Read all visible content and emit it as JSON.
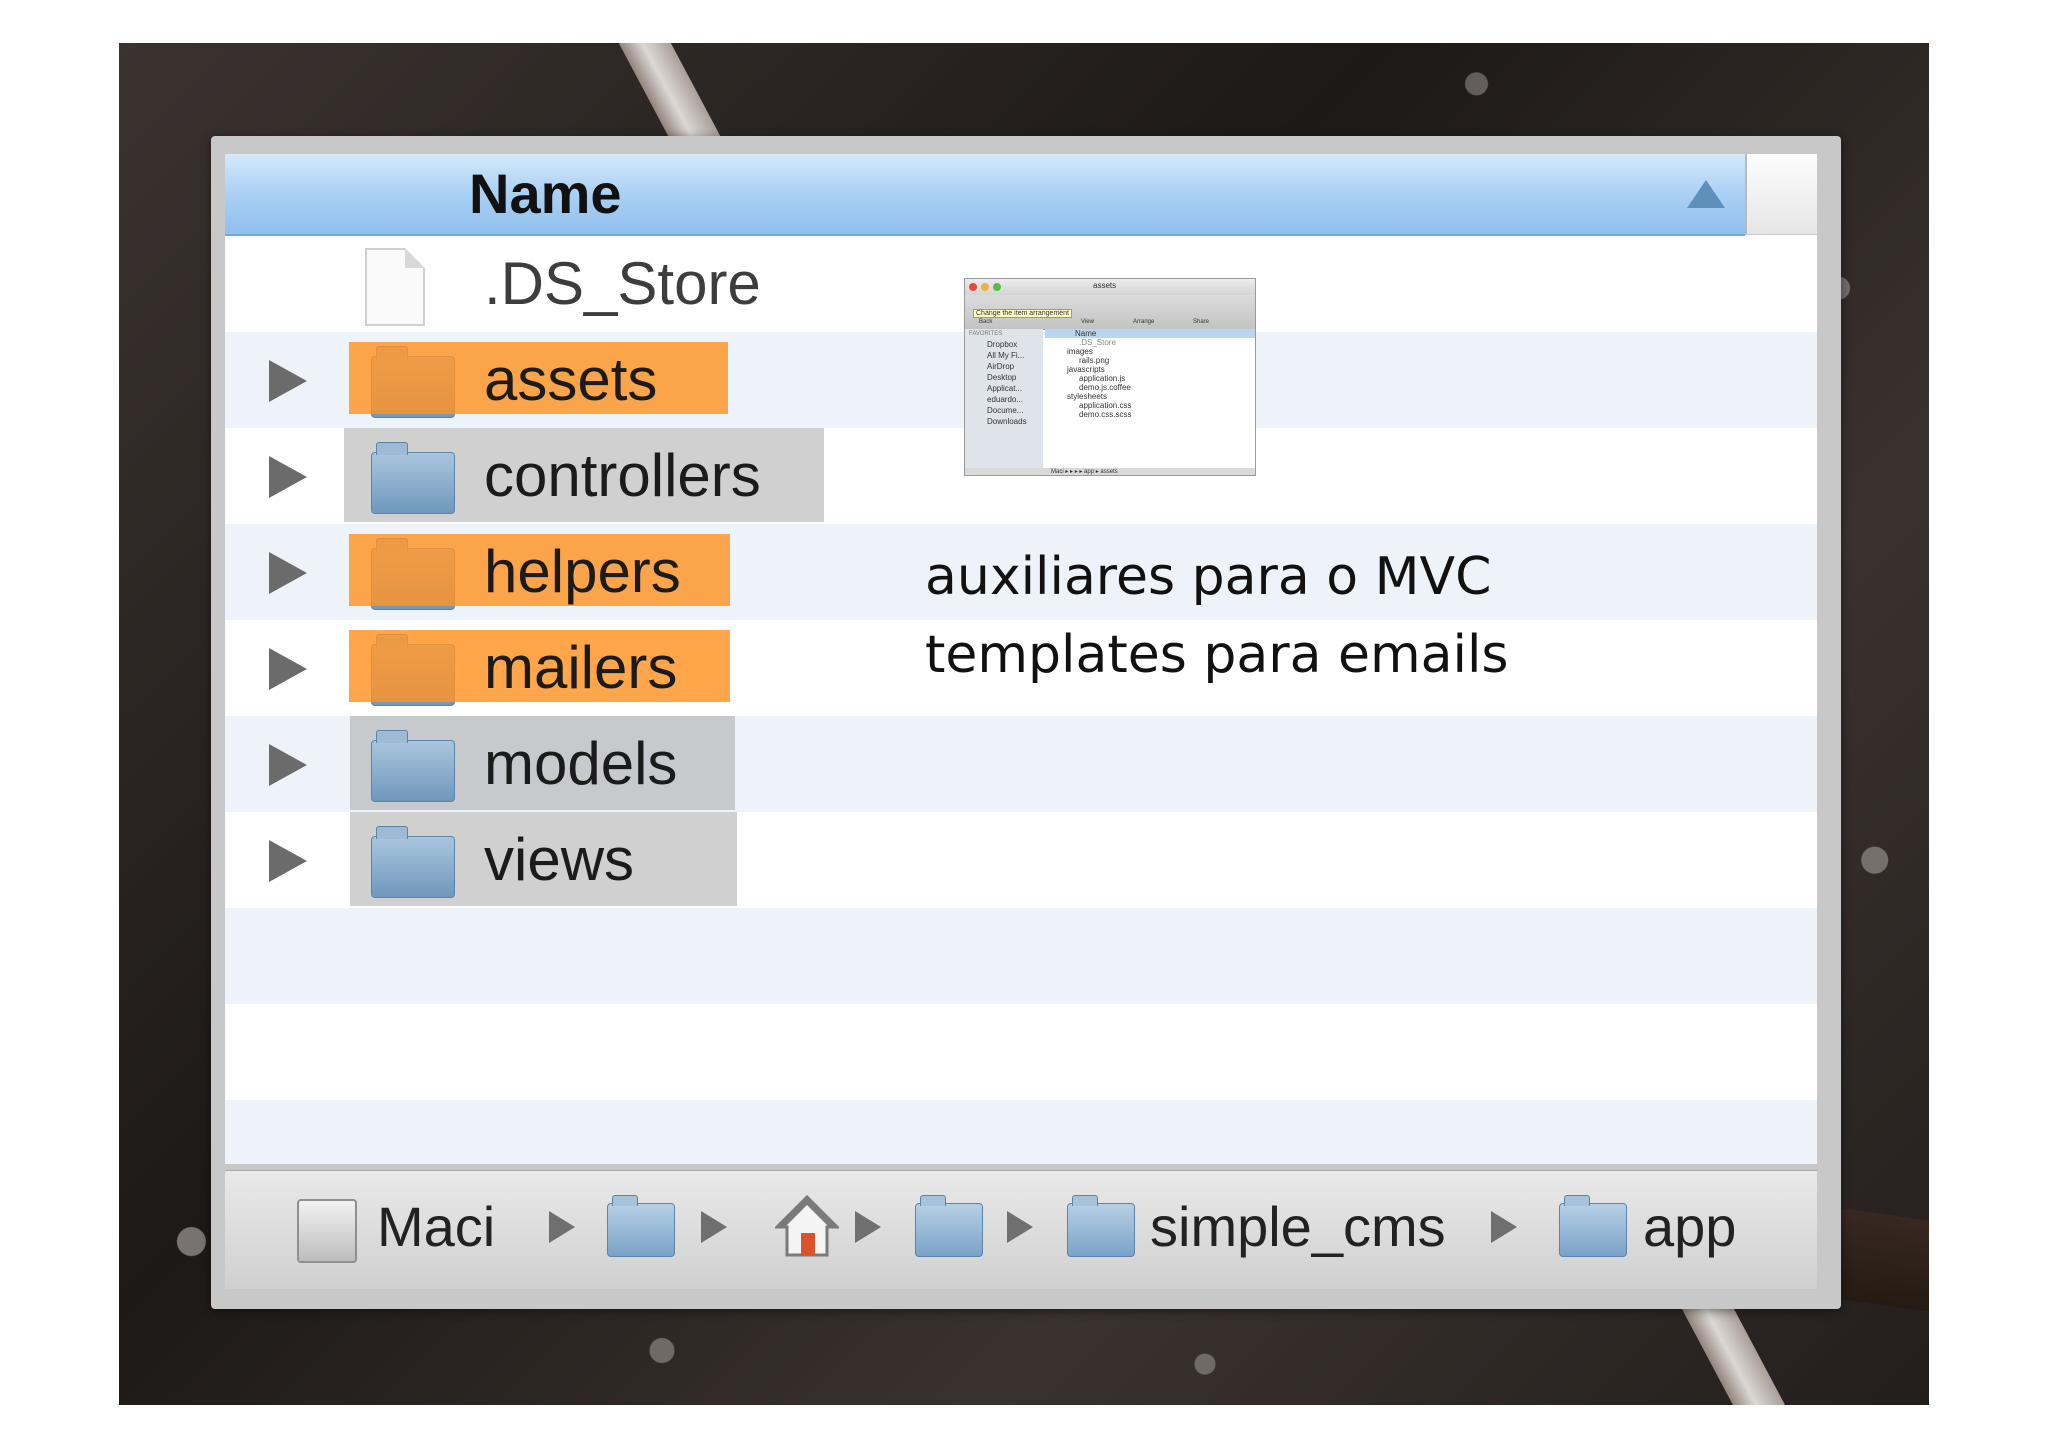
{
  "window": {
    "column_header": "Name",
    "rows": [
      {
        "label": ".DS_Store",
        "kind": "file",
        "highlight": "none"
      },
      {
        "label": "assets",
        "kind": "folder",
        "highlight": "orange"
      },
      {
        "label": "controllers",
        "kind": "folder",
        "highlight": "gray"
      },
      {
        "label": "helpers",
        "kind": "folder",
        "highlight": "orange"
      },
      {
        "label": "mailers",
        "kind": "folder",
        "highlight": "orange"
      },
      {
        "label": "models",
        "kind": "folder",
        "highlight": "gray"
      },
      {
        "label": "views",
        "kind": "folder",
        "highlight": "gray"
      }
    ]
  },
  "pathbar": {
    "disk_label": "Maci",
    "project": "simple_cms",
    "current": "app"
  },
  "annotations": {
    "helpers": "auxiliares para o MVC",
    "mailers": "templates para emails"
  },
  "mini_screenshot": {
    "title": "assets",
    "tooltip": "Change the item arrangement",
    "toolbar": [
      "Back",
      "View",
      "Arrange",
      "Share"
    ],
    "sidebar_heading": "FAVORITES",
    "sidebar_items": [
      "Dropbox",
      "All My Fi...",
      "AirDrop",
      "Desktop",
      "Applicat...",
      "eduardo...",
      "Docume...",
      "Downloads"
    ],
    "header": "Name",
    "files": [
      ".DS_Store",
      "images",
      "rails.png",
      "javascripts",
      "application.js",
      "demo.js.coffee",
      "stylesheets",
      "application.css",
      "demo.css.scss"
    ],
    "path": "Maci ▸ ▸ ▸ ▸ app ▸ assets"
  },
  "colors": {
    "highlight_orange": "#ff9223",
    "header_blue": "#aed2f5",
    "folder_blue": "#7aa3c7"
  }
}
